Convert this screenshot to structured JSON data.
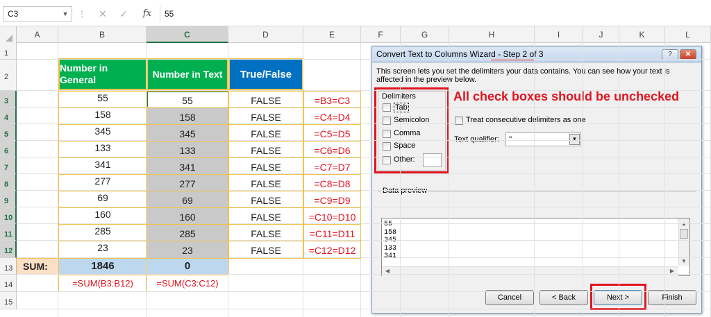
{
  "formula_bar": {
    "name_box": "C3",
    "fx": "fx",
    "cancel_icon": "✕",
    "confirm_icon": "✓",
    "value": "55"
  },
  "columns": [
    "A",
    "B",
    "C",
    "D",
    "E",
    "F",
    "G",
    "H",
    "I",
    "J",
    "K",
    "L"
  ],
  "selected_column": "C",
  "rows": [
    "1",
    "2",
    "3",
    "4",
    "5",
    "6",
    "7",
    "8",
    "9",
    "10",
    "11",
    "12",
    "13",
    "14",
    "15"
  ],
  "table": {
    "header_general": "Number in General",
    "header_text": "Number in Text",
    "header_truefalse": "True/False",
    "general_values": [
      "55",
      "158",
      "345",
      "133",
      "341",
      "277",
      "69",
      "160",
      "285",
      "23"
    ],
    "text_values": [
      "55",
      "158",
      "345",
      "133",
      "341",
      "277",
      "69",
      "160",
      "285",
      "23"
    ],
    "bool_values": [
      "FALSE",
      "FALSE",
      "FALSE",
      "FALSE",
      "FALSE",
      "FALSE",
      "FALSE",
      "FALSE",
      "FALSE",
      "FALSE"
    ],
    "formulas": [
      "=B3=C3",
      "=C4=D4",
      "=C5=D5",
      "=C6=D6",
      "=C7=D7",
      "=C8=D8",
      "=C9=D9",
      "=C10=D10",
      "=C11=D11",
      "=C12=D12"
    ],
    "sum_label": "SUM:",
    "sum_general": "1846",
    "sum_text": "0",
    "sum_formula_b": "=SUM(B3:B12)",
    "sum_formula_c": "=SUM(C3:C12)"
  },
  "dialog": {
    "title_prefix": "Convert Text to Columns Wizard - ",
    "title_step": "Step 2 of 3",
    "help": "?",
    "close": "✕",
    "description": "This screen lets you set the delimiters your data contains.  You can see how your text is affected in the preview below.",
    "delimiters_legend": "Delimiters",
    "delimiters": [
      "Tab",
      "Semicolon",
      "Comma",
      "Space",
      "Other:"
    ],
    "consecutive_label": "Treat consecutive delimiters as one",
    "qualifier_label": "Text qualifier:",
    "qualifier_value": "\"",
    "annotation": "All check boxes should be unchecked",
    "preview_legend": "Data preview",
    "preview_lines": [
      "55",
      "158",
      "345",
      "133",
      "341"
    ],
    "buttons": {
      "cancel": "Cancel",
      "back": "< Back",
      "next": "Next >",
      "finish": "Finish"
    }
  },
  "colors": {
    "green_header": "#00b050",
    "blue_header": "#0070c0",
    "annotation_red": "#e0141e",
    "gold_border": "#f2c34a"
  }
}
